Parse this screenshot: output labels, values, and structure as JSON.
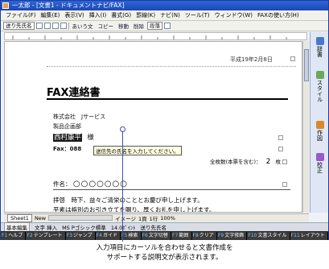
{
  "window": {
    "title": "一太郎 - [文書1 - ドキュメントナビ/FAX]"
  },
  "menu": [
    "ファイル(F)",
    "編集(E)",
    "表示(V)",
    "挿入(I)",
    "書式(G)",
    "罫線(K)",
    "ナビ(N)",
    "ツール(T)",
    "ウィンドウ(W)",
    "FAXの使い方(H)"
  ],
  "toolbar": {
    "style_select": "送り先氏名",
    "ai_label": "あいう文",
    "copy_label": "コピー",
    "move_label": "移動",
    "delete_label": "削除",
    "paragraph_select": "段落"
  },
  "side_panel": [
    {
      "label": "辞書",
      "color": "#4a78c8"
    },
    {
      "label": "スタイル",
      "color": "#6aa85a"
    },
    {
      "label": "作図",
      "color": "#d88a2a"
    },
    {
      "label": "校正",
      "color": "#9a5ac8"
    }
  ],
  "document": {
    "date": "平成19年2月8日",
    "title": "FAX連絡書",
    "lines": [
      "株式会社　Jサービス",
      "製品企画部"
    ],
    "recipient_name": "西村康平",
    "recipient_suffix": "様",
    "fax_label": "Fax：088",
    "tooltip": "送信先の氏名を入力してください。",
    "pages_label": "全枚数(本票を含む)：",
    "pages_count": "2",
    "pages_unit": "枚",
    "subject_label": "件名：",
    "subject_value": "○○○○○○○",
    "greeting1": "拝啓　時下、益々ご清栄のこととお慶び申し上げます。",
    "greeting2": "平素は格別のお引き立てを賜り、厚くお礼を申し上げます。"
  },
  "sheet_tabs": {
    "sheet": "Sheet1",
    "new": "New"
  },
  "status": {
    "mode": "基本編集",
    "image": "イメージ",
    "page": "1頁",
    "line": "1行",
    "zoom": "100%",
    "char_info": "文字 挿入",
    "ime": "MS Pゴシック標準",
    "pt": "14.0ﾎﾟｲﾝﾄ",
    "style": "送り先氏名"
  },
  "fkeys": [
    {
      "key": "F1",
      "label": "ヘルプ"
    },
    {
      "key": "F2",
      "label": "テンプレート"
    },
    {
      "key": "F3",
      "label": "ジャンプ"
    },
    {
      "key": "F4",
      "label": "ガイド"
    },
    {
      "key": "F5",
      "label": "検索"
    },
    {
      "key": "F6",
      "label": "文字切替"
    },
    {
      "key": "F7",
      "label": "範囲"
    },
    {
      "key": "F8",
      "label": "クリア"
    },
    {
      "key": "F9",
      "label": "文字修飾"
    },
    {
      "key": "F10",
      "label": "文書スタイル"
    },
    {
      "key": "F11",
      "label": "レイアウト"
    }
  ],
  "caption": {
    "line1": "入力項目にカーソルを合わせると文書作成を",
    "line2": "サポートする説明文が表示されます。"
  }
}
